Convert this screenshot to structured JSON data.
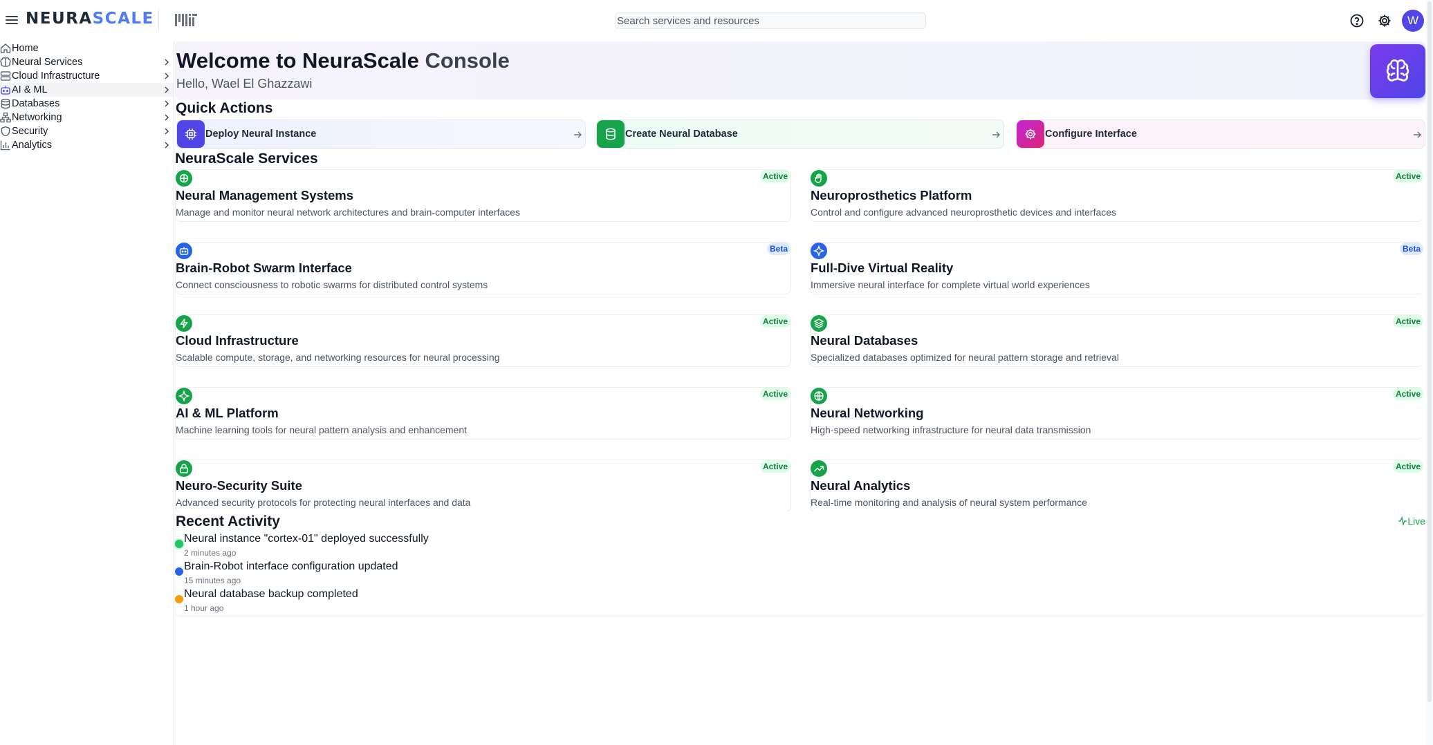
{
  "header": {
    "logo_primary": "NEURA",
    "logo_accent": "SCALE",
    "search_placeholder": "Search services and resources",
    "avatar_initial": "W"
  },
  "sidebar": {
    "items": [
      {
        "label": "Home",
        "icon": "home-icon",
        "has_chevron": false
      },
      {
        "label": "Neural Services",
        "icon": "brain-icon",
        "has_chevron": true
      },
      {
        "label": "Cloud Infrastructure",
        "icon": "server-icon",
        "has_chevron": true
      },
      {
        "label": "AI & ML",
        "icon": "bot-icon",
        "has_chevron": true,
        "active": true
      },
      {
        "label": "Databases",
        "icon": "database-icon",
        "has_chevron": true
      },
      {
        "label": "Networking",
        "icon": "network-icon",
        "has_chevron": true
      },
      {
        "label": "Security",
        "icon": "shield-icon",
        "has_chevron": true
      },
      {
        "label": "Analytics",
        "icon": "bar-chart-icon",
        "has_chevron": true
      }
    ]
  },
  "welcome": {
    "title_main": "Welcome to NeuraScale",
    "title_suffix": " Console",
    "greeting": "Hello, Wael El Ghazzawi"
  },
  "quick_actions": {
    "title": "Quick Actions",
    "items": [
      {
        "label": "Deploy Neural Instance",
        "icon": "cpu-icon",
        "color": "#4f46e5"
      },
      {
        "label": "Create Neural Database",
        "icon": "database-icon",
        "color": "#16a34a"
      },
      {
        "label": "Configure Interface",
        "icon": "gear-icon",
        "color": "#c026d3"
      }
    ]
  },
  "services": {
    "title": "NeuraScale Services",
    "items": [
      {
        "title": "Neural Management Systems",
        "desc": "Manage and monitor neural network architectures and brain-computer interfaces",
        "status": "Active"
      },
      {
        "title": "Neuroprosthetics Platform",
        "desc": "Control and configure advanced neuroprosthetic devices and interfaces",
        "status": "Active"
      },
      {
        "title": "Brain-Robot Swarm Interface",
        "desc": "Connect consciousness to robotic swarms for distributed control systems",
        "status": "Beta"
      },
      {
        "title": "Full-Dive Virtual Reality",
        "desc": "Immersive neural interface for complete virtual world experiences",
        "status": "Beta"
      },
      {
        "title": "Cloud Infrastructure",
        "desc": "Scalable compute, storage, and networking resources for neural processing",
        "status": "Active"
      },
      {
        "title": "Neural Databases",
        "desc": "Specialized databases optimized for neural pattern storage and retrieval",
        "status": "Active"
      },
      {
        "title": "AI & ML Platform",
        "desc": "Machine learning tools for neural pattern analysis and enhancement",
        "status": "Active"
      },
      {
        "title": "Neural Networking",
        "desc": "High-speed networking infrastructure for neural data transmission",
        "status": "Active"
      },
      {
        "title": "Neuro-Security Suite",
        "desc": "Advanced security protocols for protecting neural interfaces and data",
        "status": "Active"
      },
      {
        "title": "Neural Analytics",
        "desc": "Real-time monitoring and analysis of neural system performance",
        "status": "Active"
      }
    ]
  },
  "activity": {
    "title": "Recent Activity",
    "live_label": "Live",
    "items": [
      {
        "text": "Neural instance \"cortex-01\" deployed successfully",
        "time": "2 minutes ago",
        "color": "#22c55e"
      },
      {
        "text": "Brain-Robot interface configuration updated",
        "time": "15 minutes ago",
        "color": "#2563eb"
      },
      {
        "text": "Neural database backup completed",
        "time": "1 hour ago",
        "color": "#f59e0b"
      }
    ]
  }
}
